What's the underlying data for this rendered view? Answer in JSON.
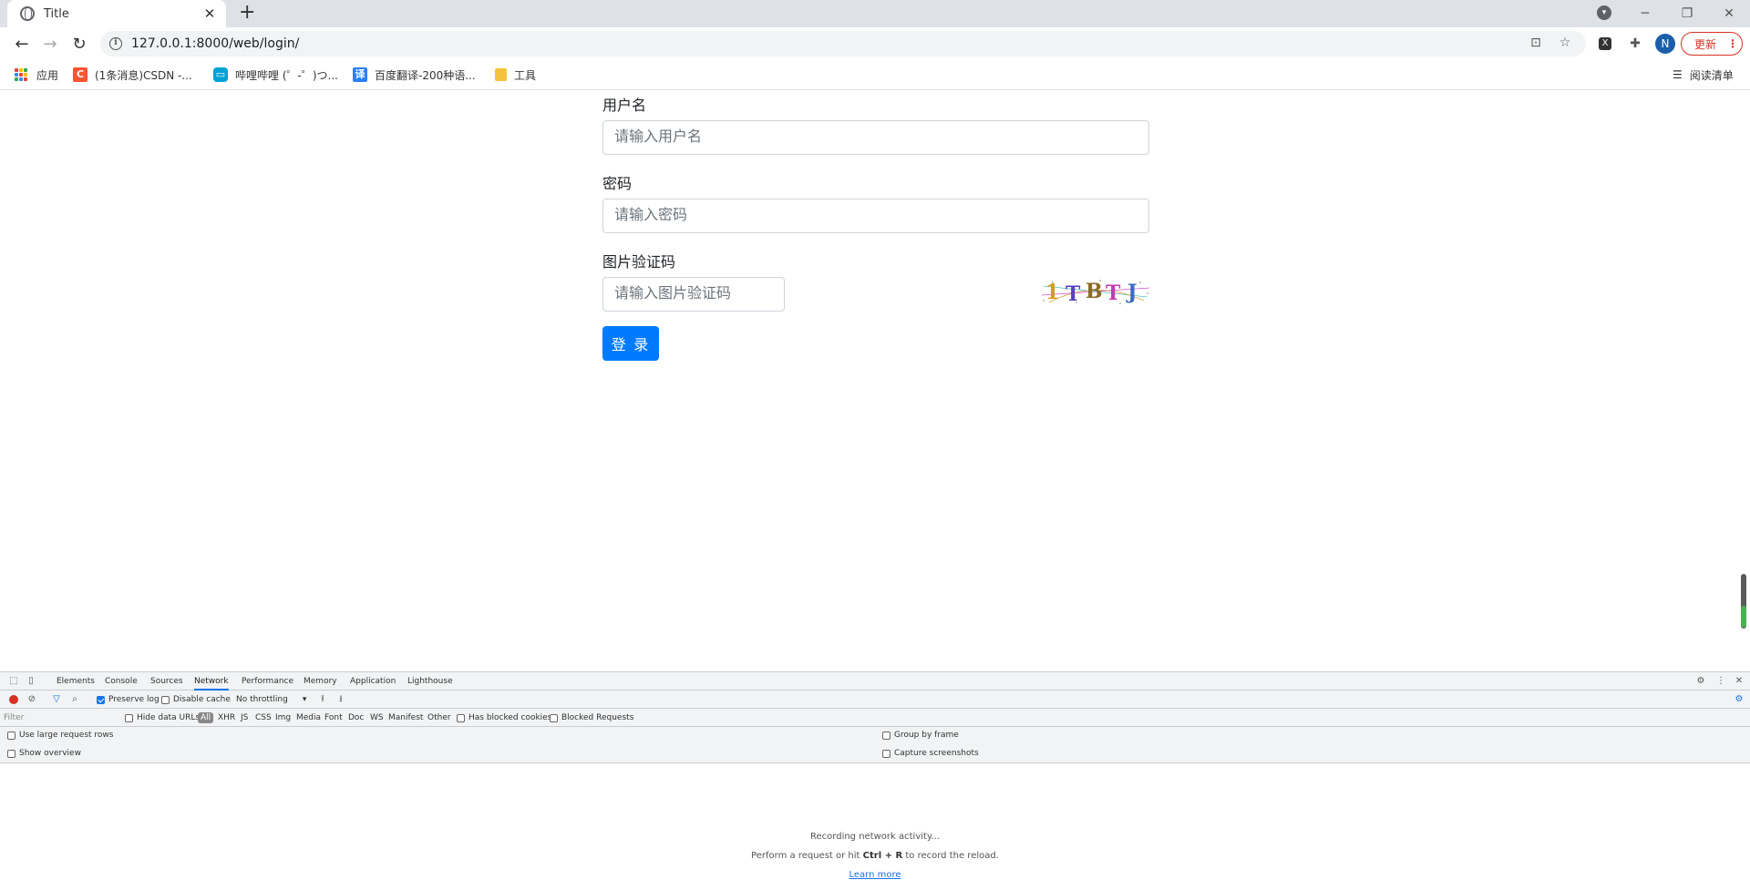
{
  "browser": {
    "tab_title": "Title",
    "tab_close": "✕",
    "new_tab": "+",
    "url": "127.0.0.1:8000/web/login/",
    "avatar_letter": "N",
    "update_label": "更新",
    "update_more": "⋮"
  },
  "bookmarks": {
    "items": [
      {
        "label": "应用",
        "icon": "apps-grid-icon"
      },
      {
        "label": "(1条消息)CSDN -...",
        "icon": "csdn-icon",
        "color": "#fc5531"
      },
      {
        "label": "哔哩哔哩 (゜-゜)つ...",
        "icon": "bilibili-icon",
        "color": "#00a1d6"
      },
      {
        "label": "百度翻译-200种语...",
        "icon": "baidu-translate-icon",
        "color": "#2b7ff7"
      },
      {
        "label": "工具",
        "icon": "folder-icon",
        "color": "#f5c33b"
      }
    ],
    "reading_list": "阅读清单"
  },
  "form": {
    "username_label": "用户名",
    "username_placeholder": "请输入用户名",
    "password_label": "密码",
    "password_placeholder": "请输入密码",
    "captcha_label": "图片验证码",
    "captcha_placeholder": "请输入图片验证码",
    "captcha_text": "1TBTJ",
    "login_button": "登 录",
    "accent": "#007bff"
  },
  "devtools": {
    "tabs": [
      "Elements",
      "Console",
      "Sources",
      "Network",
      "Performance",
      "Memory",
      "Application",
      "Lighthouse"
    ],
    "active_tab": "Network",
    "preserve_log": "Preserve log",
    "disable_cache": "Disable cache",
    "throttling": "No throttling",
    "filter_placeholder": "Filter",
    "hide_data_urls": "Hide data URLs",
    "type_filters": [
      "All",
      "XHR",
      "JS",
      "CSS",
      "Img",
      "Media",
      "Font",
      "Doc",
      "WS",
      "Manifest",
      "Other"
    ],
    "has_blocked_cookies": "Has blocked cookies",
    "blocked_requests": "Blocked Requests",
    "use_large_rows": "Use large request rows",
    "group_by_frame": "Group by frame",
    "show_overview": "Show overview",
    "capture_screenshots": "Capture screenshots",
    "recording_msg": "Recording network activity...",
    "perform_msg_pre": "Perform a request or hit ",
    "perform_msg_key": "Ctrl + R",
    "perform_msg_post": " to record the reload.",
    "learn_more": "Learn more"
  }
}
